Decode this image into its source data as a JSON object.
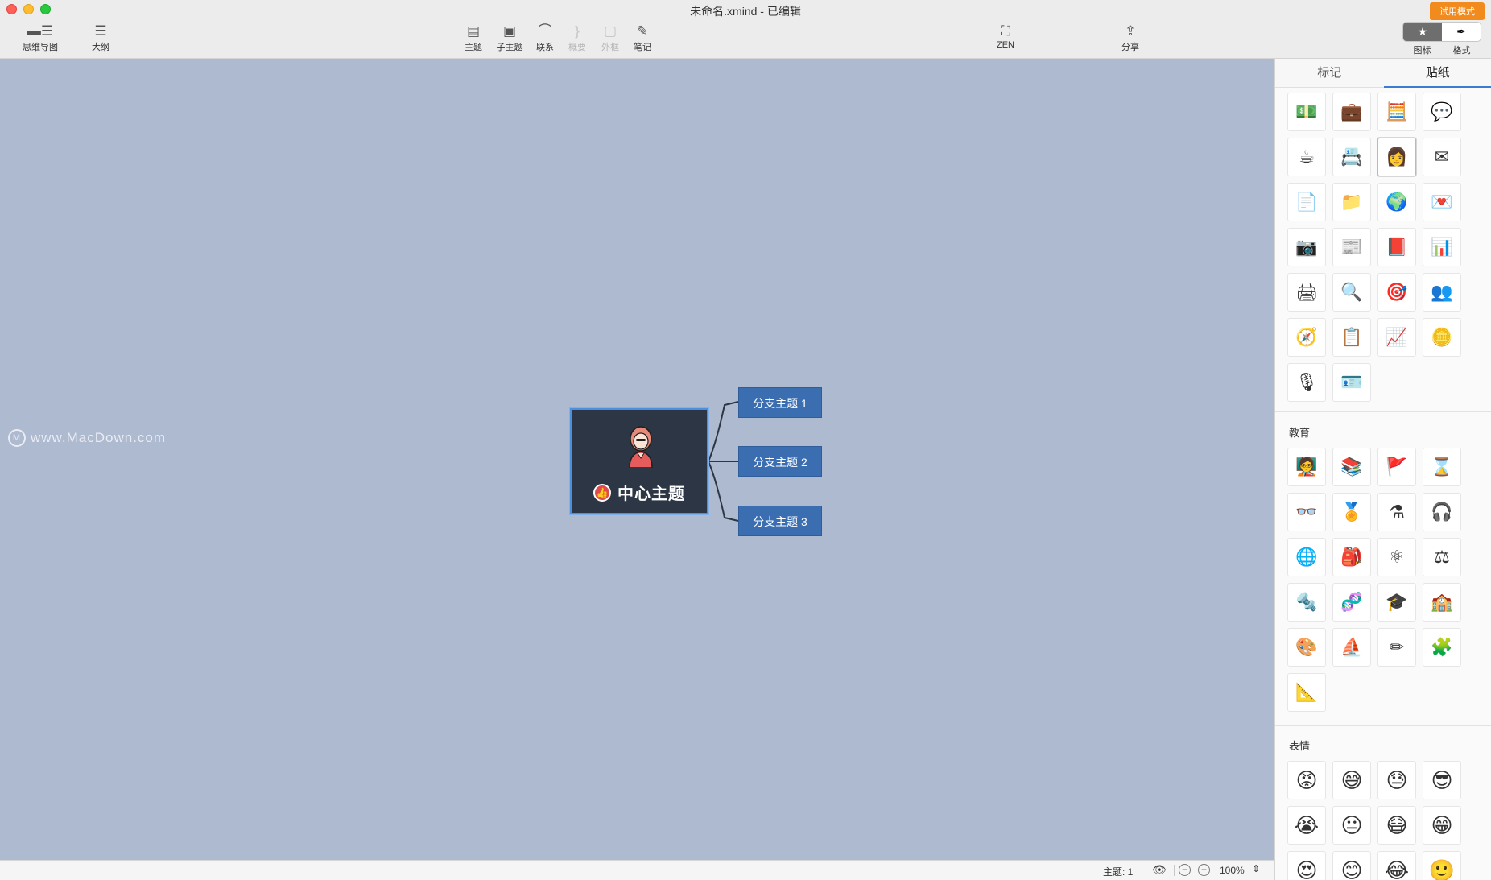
{
  "window": {
    "title": "未命名.xmind - 已编辑",
    "trial_badge": "试用模式"
  },
  "toolbar": {
    "mindmap": "思维导图",
    "outline": "大纲",
    "topic": "主题",
    "subtopic": "子主题",
    "relationship": "联系",
    "summary": "概要",
    "boundary": "外框",
    "notes": "笔记",
    "zen": "ZEN",
    "share": "分享",
    "icons": "图标",
    "format": "格式"
  },
  "canvas": {
    "watermark": "www.MacDown.com",
    "central_topic": "中心主题",
    "branches": [
      "分支主题 1",
      "分支主题 2",
      "分支主题 3"
    ]
  },
  "statusbar": {
    "topic_count": "主题: 1",
    "zoom": "100%"
  },
  "panel": {
    "tabs": [
      "标记",
      "贴纸"
    ],
    "active_tab": "贴纸",
    "business_stickers": [
      {
        "name": "money-sticker",
        "glyph": "💵"
      },
      {
        "name": "briefcase-sticker",
        "glyph": "💼"
      },
      {
        "name": "calculator-sticker",
        "glyph": "🧮"
      },
      {
        "name": "chat-bubble-sticker",
        "glyph": "💬"
      },
      {
        "name": "coffee-sticker",
        "glyph": "☕"
      },
      {
        "name": "contact-card-sticker",
        "glyph": "📇"
      },
      {
        "name": "woman-avatar-sticker",
        "glyph": "👩"
      },
      {
        "name": "envelope-sticker",
        "glyph": "✉"
      },
      {
        "name": "document-search-sticker",
        "glyph": "📄"
      },
      {
        "name": "folder-sticker",
        "glyph": "📁"
      },
      {
        "name": "globe-sticker",
        "glyph": "🌍"
      },
      {
        "name": "letter-sticker",
        "glyph": "💌"
      },
      {
        "name": "camera-sticker",
        "glyph": "📷"
      },
      {
        "name": "newspaper-sticker",
        "glyph": "📰"
      },
      {
        "name": "book-sticker",
        "glyph": "📕"
      },
      {
        "name": "presentation-sticker",
        "glyph": "📊"
      },
      {
        "name": "printer-sticker",
        "glyph": "🖨"
      },
      {
        "name": "magnifier-sticker",
        "glyph": "🔍"
      },
      {
        "name": "target-sticker",
        "glyph": "🎯"
      },
      {
        "name": "team-sticker",
        "glyph": "👥"
      },
      {
        "name": "compass-sticker",
        "glyph": "🧭"
      },
      {
        "name": "checklist-sticker",
        "glyph": "📋"
      },
      {
        "name": "bar-chart-sticker",
        "glyph": "📈"
      },
      {
        "name": "coins-sticker",
        "glyph": "🪙"
      },
      {
        "name": "microphone-sticker",
        "glyph": "🎙"
      },
      {
        "name": "id-card-sticker",
        "glyph": "🪪"
      }
    ],
    "education_title": "教育",
    "education_stickers": [
      {
        "name": "blackboard-sticker",
        "glyph": "🧑‍🏫"
      },
      {
        "name": "books-sticker",
        "glyph": "📚"
      },
      {
        "name": "flag-sticker",
        "glyph": "🚩"
      },
      {
        "name": "hourglass-sticker",
        "glyph": "⌛"
      },
      {
        "name": "glasses-sticker",
        "glyph": "👓"
      },
      {
        "name": "medal-sticker",
        "glyph": "🏅"
      },
      {
        "name": "flask-sticker",
        "glyph": "⚗"
      },
      {
        "name": "headphones-sticker",
        "glyph": "🎧"
      },
      {
        "name": "globe-stand-sticker",
        "glyph": "🌐"
      },
      {
        "name": "backpack-sticker",
        "glyph": "🎒"
      },
      {
        "name": "atom-sticker",
        "glyph": "⚛"
      },
      {
        "name": "scales-sticker",
        "glyph": "⚖"
      },
      {
        "name": "newtons-cradle-sticker",
        "glyph": "🔩"
      },
      {
        "name": "dna-sticker",
        "glyph": "🧬"
      },
      {
        "name": "graduation-cap-sticker",
        "glyph": "🎓"
      },
      {
        "name": "school-sticker",
        "glyph": "🏫"
      },
      {
        "name": "palette-sticker",
        "glyph": "🎨"
      },
      {
        "name": "paper-boat-sticker",
        "glyph": "⛵"
      },
      {
        "name": "ruler-pencil-sticker",
        "glyph": "✏"
      },
      {
        "name": "puzzle-sticker",
        "glyph": "🧩"
      },
      {
        "name": "set-square-sticker",
        "glyph": "📐"
      }
    ],
    "emotion_title": "表情",
    "emotion_stickers": [
      {
        "name": "angry-face-sticker",
        "glyph": "😡"
      },
      {
        "name": "sweat-smile-sticker",
        "glyph": "😅"
      },
      {
        "name": "sad-sweat-sticker",
        "glyph": "😓"
      },
      {
        "name": "sunglasses-sticker",
        "glyph": "😎"
      },
      {
        "name": "crying-sticker",
        "glyph": "😭"
      },
      {
        "name": "neutral-sticker",
        "glyph": "😐"
      },
      {
        "name": "mask-sticker",
        "glyph": "😷"
      },
      {
        "name": "grin-sticker",
        "glyph": "😁"
      },
      {
        "name": "heart-eyes-sticker",
        "glyph": "😍"
      },
      {
        "name": "blush-sticker",
        "glyph": "😊"
      },
      {
        "name": "laughing-tears-sticker",
        "glyph": "😂"
      },
      {
        "name": "slight-smile-sticker",
        "glyph": "🙂"
      }
    ]
  },
  "colors": {
    "canvas_bg": "#aebacf",
    "central_bg": "#2c3645",
    "central_border": "#4a90e2",
    "branch_bg": "#3a6eb1",
    "accent": "#3b7bd1",
    "trial_badge": "#f28b1e"
  }
}
